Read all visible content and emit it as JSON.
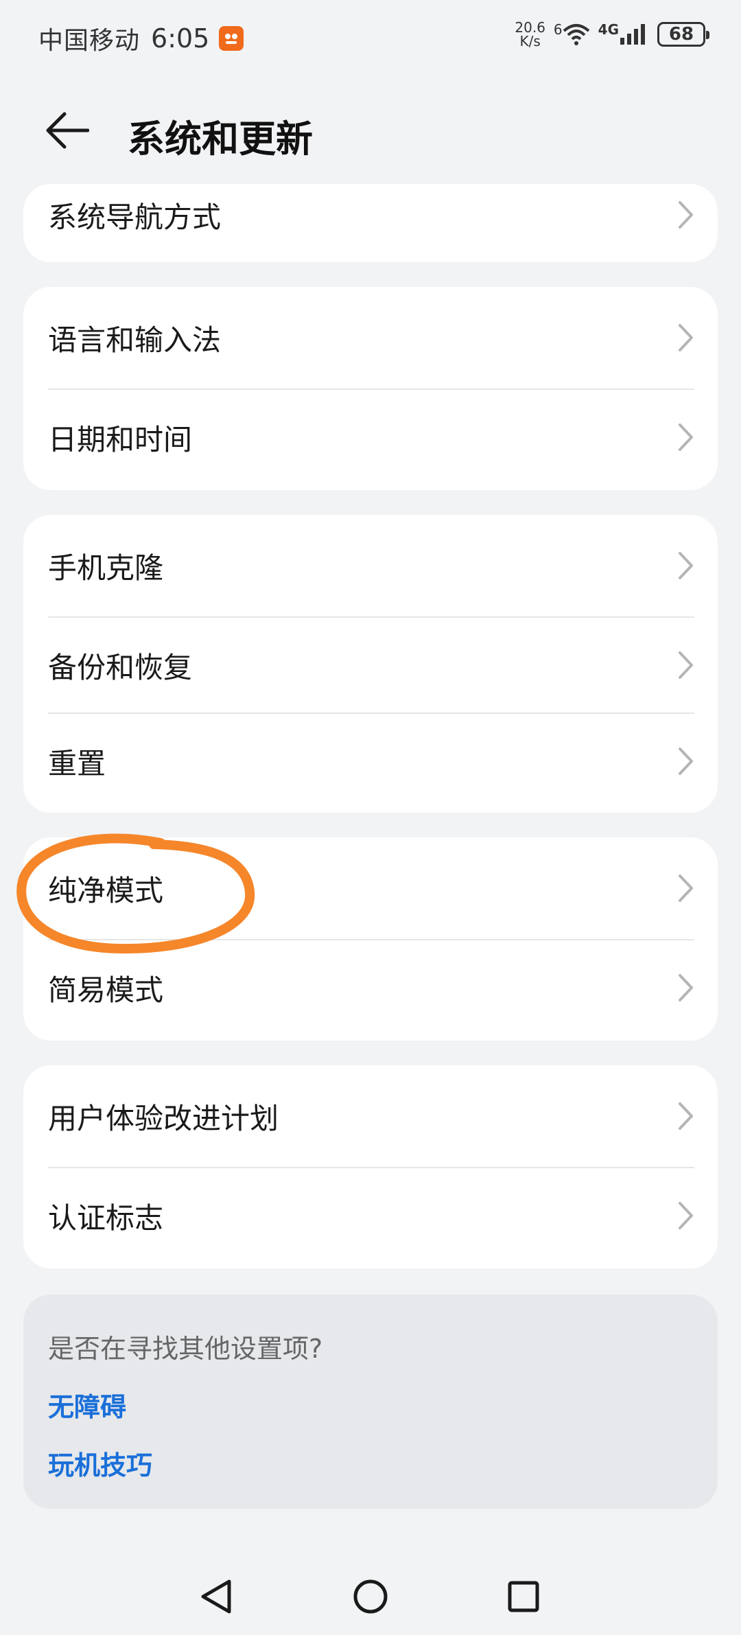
{
  "status_bar": {
    "carrier": "中国移动",
    "time": "6:05",
    "network_speed_value": "20.6",
    "network_speed_unit": "K/s",
    "wifi_label": "6",
    "cellular_label": "4G",
    "battery": "68"
  },
  "header": {
    "title": "系统和更新"
  },
  "groups": [
    {
      "items": [
        {
          "label": "系统导航方式"
        }
      ]
    },
    {
      "items": [
        {
          "label": "语言和输入法"
        },
        {
          "label": "日期和时间"
        }
      ]
    },
    {
      "items": [
        {
          "label": "手机克隆"
        },
        {
          "label": "备份和恢复"
        },
        {
          "label": "重置"
        }
      ]
    },
    {
      "items": [
        {
          "label": "纯净模式"
        },
        {
          "label": "简易模式"
        }
      ]
    },
    {
      "items": [
        {
          "label": "用户体验改进计划"
        },
        {
          "label": "认证标志"
        }
      ]
    }
  ],
  "suggestions": {
    "question": "是否在寻找其他设置项?",
    "links": [
      "无障碍",
      "玩机技巧"
    ]
  },
  "colors": {
    "background": "#f1f3f5",
    "card": "#ffffff",
    "link": "#1a6fd9",
    "annotation": "#f5862a"
  }
}
